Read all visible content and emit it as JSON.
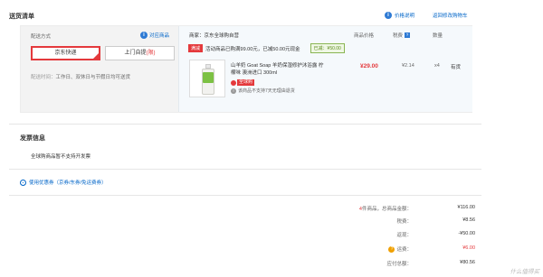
{
  "header": {
    "title": "送货清单",
    "price_help": "价格说明",
    "back_to_cart": "返回修改购物车"
  },
  "delivery": {
    "label": "配送方式",
    "support_link": "对应商品",
    "options": [
      {
        "label": "京东快递",
        "extra": "",
        "selected": true
      },
      {
        "label": "上门自提",
        "extra": "(限)",
        "selected": false
      }
    ],
    "time_label": "配送时间：",
    "time_value": "工作日、双休日与节假日均可送货"
  },
  "order": {
    "store": "商家：京东全球购自营",
    "columns": {
      "price": "商品价格",
      "tax": "税费",
      "qty": "数量"
    },
    "promo": {
      "tag": "满减",
      "text_prefix": "活动商品已购满99.00元，已减50.00元现金",
      "saved": "已减：¥50.00"
    },
    "product": {
      "name": "山羊奶 Goat Soap 羊奶保湿修护沐浴露 柠檬味 澳洲进口 300ml",
      "global_tag": "全球购",
      "return_note": "该商品不支持7天无理由退货",
      "price": "¥29.00",
      "tax": "¥2.14",
      "qty": "x4",
      "stock": "有货"
    }
  },
  "invoice": {
    "title": "发票信息",
    "note": "全球购商品暂不支持开发票"
  },
  "coupon": {
    "label": "使用优惠券（京券/东券/免运费券）"
  },
  "summary": {
    "count_num": "4",
    "count_label": "件商品，总商品金额：",
    "count_value": "¥116.00",
    "tax_label": "税费：",
    "tax_value": "¥8.56",
    "discount_label": "返现：",
    "discount_value": "-¥50.00",
    "shipping_label": "运费：",
    "shipping_value": "¥6.00",
    "total_label": "应付总额：",
    "total_value": "¥80.56"
  },
  "watermark": "什么值得买"
}
